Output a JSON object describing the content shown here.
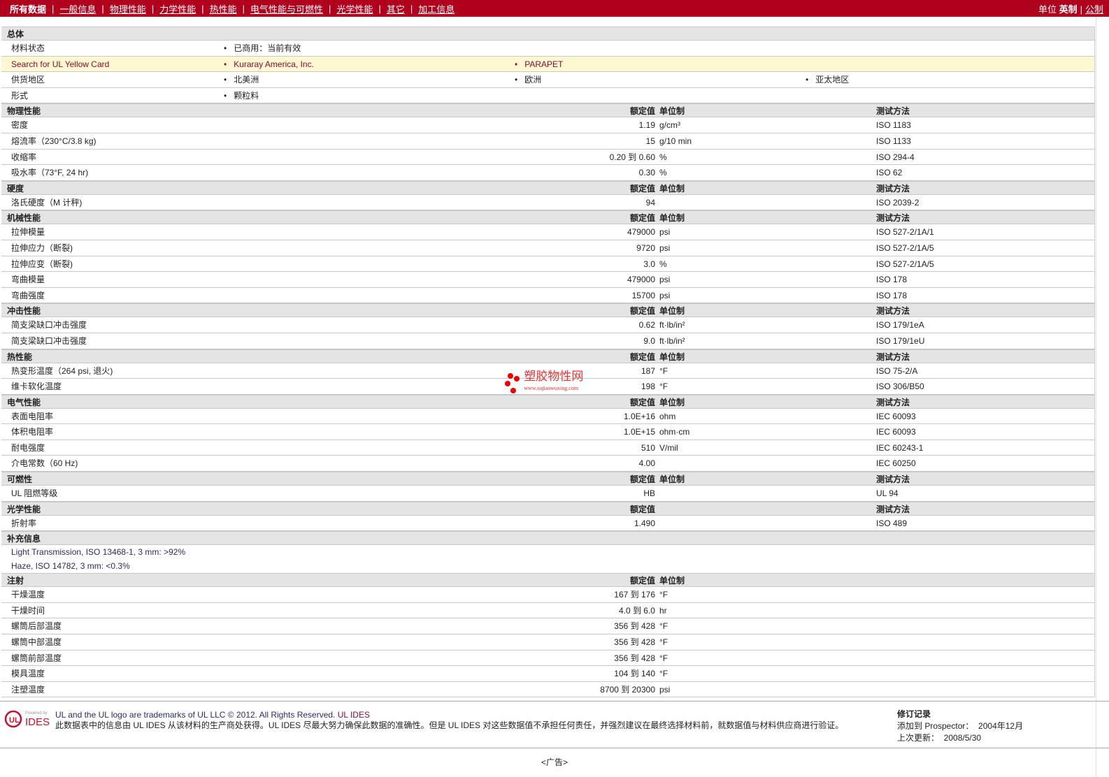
{
  "nav": {
    "items": [
      "所有数据",
      "一般信息",
      "物理性能",
      "力学性能",
      "热性能",
      "电气性能与可燃性",
      "光学性能",
      "其它",
      "加工信息"
    ],
    "units_label": "单位",
    "units": [
      "英制",
      "公制"
    ]
  },
  "headers": {
    "nominal": "额定值",
    "unit": "单位制",
    "method": "测试方法"
  },
  "general": {
    "title": "总体",
    "rows": [
      {
        "label": "材料状态",
        "items": [
          "已商用：当前有效"
        ]
      },
      {
        "label": "Search for UL Yellow Card",
        "items": [
          "Kuraray America, Inc.",
          "PARAPET"
        ],
        "highlight": true
      },
      {
        "label": "供货地区",
        "items": [
          "北美洲",
          "欧洲",
          "亚太地区"
        ]
      },
      {
        "label": "形式",
        "items": [
          "颗粒料"
        ]
      }
    ]
  },
  "sections": [
    {
      "title": "物理性能",
      "cols": [
        1,
        1,
        1
      ],
      "rows": [
        {
          "label": "密度",
          "value": "1.19",
          "unit": "g/cm³",
          "method": "ISO 1183"
        },
        {
          "label": "熔流率（230°C/3.8 kg)",
          "value": "15",
          "unit": "g/10 min",
          "method": "ISO 1133"
        },
        {
          "label": "收缩率",
          "value": "0.20 到  0.60",
          "unit": "%",
          "method": "ISO 294-4"
        },
        {
          "label": "吸水率（73°F, 24 hr)",
          "value": "0.30",
          "unit": "%",
          "method": "ISO 62"
        }
      ]
    },
    {
      "title": "硬度",
      "cols": [
        1,
        1,
        1
      ],
      "rows": [
        {
          "label": "洛氏硬度（M 计秤)",
          "value": "94",
          "unit": "",
          "method": "ISO 2039-2"
        }
      ]
    },
    {
      "title": "机械性能",
      "cols": [
        1,
        1,
        1
      ],
      "rows": [
        {
          "label": "拉伸模量",
          "value": "479000",
          "unit": "psi",
          "method": "ISO 527-2/1A/1"
        },
        {
          "label": "拉伸应力（断裂)",
          "value": "9720",
          "unit": "psi",
          "method": "ISO 527-2/1A/5"
        },
        {
          "label": "拉伸应变（断裂)",
          "value": "3.0",
          "unit": "%",
          "method": "ISO 527-2/1A/5"
        },
        {
          "label": "弯曲模量",
          "value": "479000",
          "unit": "psi",
          "method": "ISO 178"
        },
        {
          "label": "弯曲强度",
          "value": "15700",
          "unit": "psi",
          "method": "ISO 178"
        }
      ]
    },
    {
      "title": "冲击性能",
      "cols": [
        1,
        1,
        1
      ],
      "rows": [
        {
          "label": "简支梁缺口冲击强度",
          "value": "0.62",
          "unit": "ft·lb/in²",
          "method": "ISO 179/1eA"
        },
        {
          "label": "简支梁缺口冲击强度",
          "value": "9.0",
          "unit": "ft·lb/in²",
          "method": "ISO 179/1eU"
        }
      ]
    },
    {
      "title": "热性能",
      "cols": [
        1,
        1,
        1
      ],
      "rows": [
        {
          "label": "热变形温度（264 psi, 退火)",
          "value": "187",
          "unit": "°F",
          "method": "ISO 75-2/A"
        },
        {
          "label": "维卡软化温度",
          "value": "198",
          "unit": "°F",
          "method": "ISO 306/B50"
        }
      ]
    },
    {
      "title": "电气性能",
      "cols": [
        1,
        1,
        1
      ],
      "rows": [
        {
          "label": "表面电阻率",
          "value": "1.0E+16",
          "unit": "ohm",
          "method": "IEC 60093"
        },
        {
          "label": "体积电阻率",
          "value": "1.0E+15",
          "unit": "ohm·cm",
          "method": "IEC 60093"
        },
        {
          "label": "耐电强度",
          "value": "510",
          "unit": "V/mil",
          "method": "IEC 60243-1"
        },
        {
          "label": "介电常数（60 Hz)",
          "value": "4.00",
          "unit": "",
          "method": "IEC 60250"
        }
      ]
    },
    {
      "title": "可燃性",
      "cols": [
        1,
        1,
        1
      ],
      "rows": [
        {
          "label": "UL 阻燃等级",
          "value": "HB",
          "unit": "",
          "method": "UL 94"
        }
      ]
    },
    {
      "title": "光学性能",
      "cols": [
        1,
        0,
        1
      ],
      "rows": [
        {
          "label": "折射率",
          "value": "1.490",
          "unit": "",
          "method": "ISO 489"
        }
      ]
    },
    {
      "title": "补充信息",
      "cols": [
        0,
        0,
        0
      ],
      "notes": [
        "Light Transmission, ISO 13468-1, 3 mm: >92%",
        "Haze, ISO 14782, 3 mm: <0.3%"
      ],
      "rows": []
    },
    {
      "title": "注射",
      "cols": [
        1,
        1,
        0
      ],
      "rows": [
        {
          "label": "干燥温度",
          "value": "167 到  176",
          "unit": "°F",
          "method": ""
        },
        {
          "label": "干燥时间",
          "value": "4.0 到  6.0",
          "unit": "hr",
          "method": ""
        },
        {
          "label": "螺筒后部温度",
          "value": "356 到  428",
          "unit": "°F",
          "method": ""
        },
        {
          "label": "螺筒中部温度",
          "value": "356 到  428",
          "unit": "°F",
          "method": ""
        },
        {
          "label": "螺筒前部温度",
          "value": "356 到  428",
          "unit": "°F",
          "method": ""
        },
        {
          "label": "模具温度",
          "value": "104 到  140",
          "unit": "°F",
          "method": ""
        },
        {
          "label": "注塑温度",
          "value": "8700 到  20300",
          "unit": "psi",
          "method": ""
        }
      ]
    }
  ],
  "footer": {
    "logo_text": "Powered by UL IDES",
    "trademark": "UL and the UL logo are trademarks of UL LLC © 2012. All Rights Reserved.",
    "trademark_link": "UL IDES",
    "disclaimer": "此数据表中的信息由 UL IDES 从该材料的生产商处获得。UL IDES 尽最大努力确保此数据的准确性。但是 UL IDES 对这些数据值不承担任何责任，并强烈建议在最终选择材料前，就数据值与材料供应商进行验证。",
    "revision_title": "修订记录",
    "added_label": "添加到 Prospector：",
    "added_date": "2004年12月",
    "updated_label": "上次更新：",
    "updated_date": "2008/5/30"
  },
  "ad": "<广告>",
  "watermark": {
    "name": "塑胶物性网",
    "url": "www.sujiaowuxing.com"
  }
}
